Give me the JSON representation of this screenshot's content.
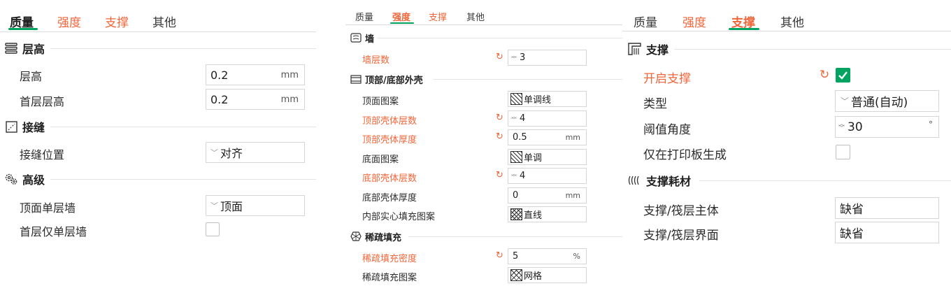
{
  "colors": {
    "accent_green": "#00a35f",
    "modified_orange": "#f0663a"
  },
  "left": {
    "tabs": [
      "质量",
      "强度",
      "支撑",
      "其他"
    ],
    "sections": {
      "layer_height": {
        "title": "层高",
        "icon": "layers-icon"
      },
      "seam": {
        "title": "接缝",
        "icon": "seam-icon"
      },
      "advanced": {
        "title": "高级",
        "icon": "gears-icon"
      }
    },
    "rows": {
      "layer_height": {
        "label": "层高",
        "value": "0.2",
        "unit": "mm"
      },
      "first_layer_height": {
        "label": "首层层高",
        "value": "0.2",
        "unit": "mm"
      },
      "seam_position": {
        "label": "接缝位置",
        "value": "对齐"
      },
      "top_single_wall": {
        "label": "顶面单层墙",
        "value": "顶面"
      },
      "first_single_wall": {
        "label": "首层仅单层墙",
        "checked": false
      }
    }
  },
  "middle": {
    "tabs": [
      "质量",
      "强度",
      "支撑",
      "其他"
    ],
    "sections": {
      "walls": {
        "title": "墙",
        "icon": "wall-icon"
      },
      "shell": {
        "title": "顶部/底部外壳",
        "icon": "shell-icon"
      },
      "infill": {
        "title": "稀疏填充",
        "icon": "infill-icon"
      }
    },
    "rows": {
      "wall_loops": {
        "label": "墙层数",
        "value": "3"
      },
      "top_pattern": {
        "label": "顶面图案",
        "value": "单调线"
      },
      "top_layers": {
        "label": "顶部壳体层数",
        "value": "4"
      },
      "top_thickness": {
        "label": "顶部壳体厚度",
        "value": "0.5",
        "unit": "mm"
      },
      "bottom_pattern": {
        "label": "底面图案",
        "value": "单调"
      },
      "bottom_layers": {
        "label": "底部壳体层数",
        "value": "4"
      },
      "bottom_thickness": {
        "label": "底部壳体厚度",
        "value": "0",
        "unit": "mm"
      },
      "internal_pattern": {
        "label": "内部实心填充图案",
        "value": "直线"
      },
      "infill_density": {
        "label": "稀疏填充密度",
        "value": "5",
        "unit": "%"
      },
      "infill_pattern": {
        "label": "稀疏填充图案",
        "value": "网格"
      }
    }
  },
  "right": {
    "tabs": [
      "质量",
      "强度",
      "支撑",
      "其他"
    ],
    "sections": {
      "support": {
        "title": "支撑",
        "icon": "support-icon"
      },
      "filament": {
        "title": "支撑耗材",
        "icon": "filament-icon"
      }
    },
    "rows": {
      "enable_support": {
        "label": "开启支撑",
        "checked": true
      },
      "type": {
        "label": "类型",
        "value": "普通(自动)"
      },
      "threshold": {
        "label": "阈值角度",
        "value": "30",
        "unit": "°"
      },
      "build_plate_only": {
        "label": "仅在打印板生成",
        "checked": false
      },
      "base_filament": {
        "label": "支撑/筏层主体",
        "value": "缺省"
      },
      "interface_filament": {
        "label": "支撑/筏层界面",
        "value": "缺省"
      }
    }
  }
}
